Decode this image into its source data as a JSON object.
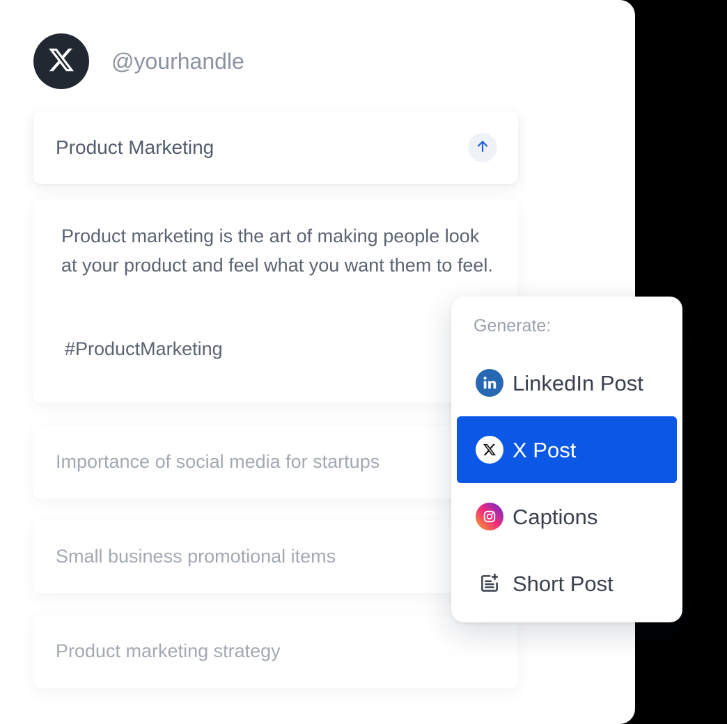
{
  "profile": {
    "handle": "@yourhandle",
    "avatar_icon": "x-logo-icon"
  },
  "prompt": {
    "text": "Product Marketing",
    "send_icon": "arrow-up-icon"
  },
  "output": {
    "body": "Product marketing is the art of making people look at your product and feel what you want them to feel.",
    "hashtag": "#ProductMarketing"
  },
  "suggestions": [
    "Importance of social media for startups",
    "Small business promotional items",
    "Product marketing strategy"
  ],
  "generate_menu": {
    "title": "Generate:",
    "options": [
      {
        "label": "LinkedIn Post",
        "icon": "linkedin-icon",
        "selected": false
      },
      {
        "label": "X Post",
        "icon": "x-logo-icon",
        "selected": true
      },
      {
        "label": "Captions",
        "icon": "instagram-icon",
        "selected": false
      },
      {
        "label": "Short Post",
        "icon": "note-add-icon",
        "selected": false
      }
    ]
  },
  "colors": {
    "accent": "#0b57e6",
    "linkedin": "#2867b2",
    "avatar_bg": "#222831"
  }
}
